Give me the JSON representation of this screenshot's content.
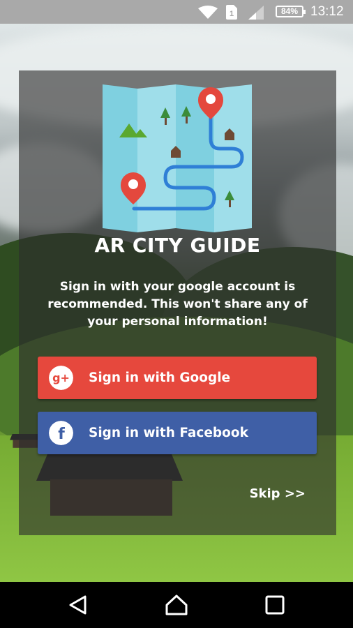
{
  "status_bar": {
    "battery_level": "84%",
    "sim_slot": "1",
    "time": "13:12",
    "icons": [
      "wifi-icon",
      "sim-card-icon",
      "cell-signal-icon",
      "battery-icon"
    ]
  },
  "card": {
    "app_title": "AR CITY GUIDE",
    "message": "Sign in with your google account is recommended. This won't share any of your personal information!",
    "google_button": {
      "label": "Sign in with Google",
      "icon": "google-plus-icon",
      "icon_text": "g+",
      "color": "#e6483d"
    },
    "facebook_button": {
      "label": "Sign in with Facebook",
      "icon": "facebook-icon",
      "icon_text": "f",
      "color": "#3f5fa6"
    },
    "skip_label": "Skip >>"
  },
  "logo": {
    "icon": "city-map-icon",
    "colors": {
      "map": "#7fd0e0",
      "map_fold": "#5bb8cc",
      "pin": "#e4483d",
      "route": "#2f7fd6",
      "tree": "#3b8c3a",
      "house": "#6e4a34"
    }
  },
  "nav_bar": {
    "buttons": [
      "back-icon",
      "home-icon",
      "recents-icon"
    ]
  }
}
